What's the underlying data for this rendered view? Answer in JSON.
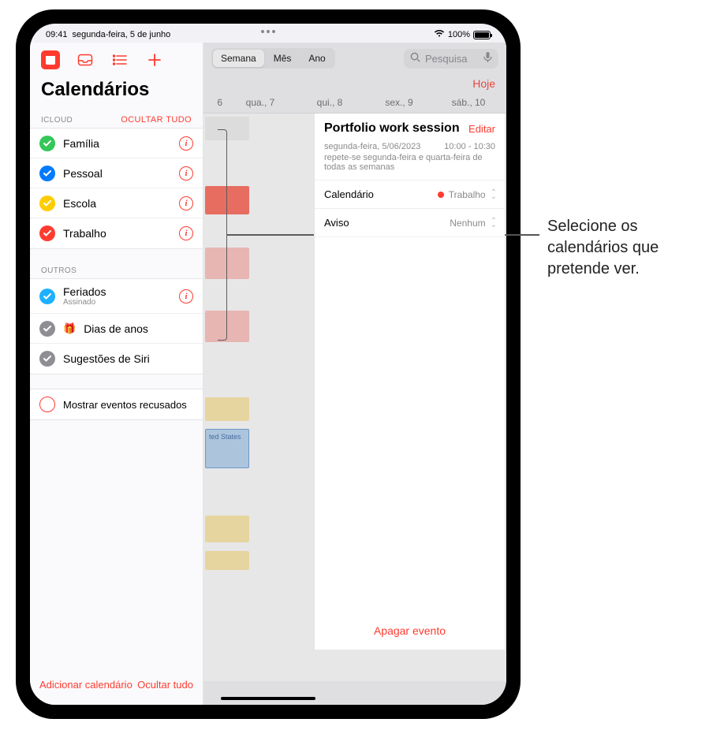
{
  "status": {
    "time": "09:41",
    "date": "segunda-feira, 5 de junho",
    "battery_pct": "100%"
  },
  "sidebar": {
    "title": "Calendários",
    "sections": {
      "icloud": {
        "name": "ICLOUD",
        "action": "OCULTAR TUDO"
      },
      "outros": {
        "name": "OUTROS"
      }
    },
    "icloud_items": [
      {
        "label": "Família",
        "color": "#34c759"
      },
      {
        "label": "Pessoal",
        "color": "#007aff"
      },
      {
        "label": "Escola",
        "color": "#ffcc00"
      },
      {
        "label": "Trabalho",
        "color": "#ff3b30"
      }
    ],
    "outros_items": [
      {
        "label": "Feriados",
        "sub": "Assinado",
        "color": "#1db0ff",
        "has_info": true
      },
      {
        "label": "Dias de anos",
        "color": "#8e8e93",
        "birthday": true
      },
      {
        "label": "Sugestões de Siri",
        "color": "#8e8e93"
      }
    ],
    "declined_label": "Mostrar eventos recusados",
    "footer": {
      "add": "Adicionar calendário",
      "hide": "Ocultar tudo"
    }
  },
  "main": {
    "segments": {
      "week": "Semana",
      "month": "Mês",
      "year": "Ano"
    },
    "search_placeholder": "Pesquisa",
    "today": "Hoje",
    "day_headers": {
      "d0": "6",
      "d1": "qua., 7",
      "d2": "qui., 8",
      "d3": "sex., 9",
      "d4": "sáb., 10"
    },
    "snippet_label": "ted States"
  },
  "event": {
    "title": "Portfolio work session",
    "edit": "Editar",
    "date": "segunda-feira, 5/06/2023",
    "time": "10:00 - 10:30",
    "recurrence": "repete-se segunda-feira e quarta-feira de todas as semanas",
    "calendar_field": "Calendário",
    "calendar_value": "Trabalho",
    "aviso_field": "Aviso",
    "aviso_value": "Nenhum",
    "delete": "Apagar evento"
  },
  "callout": {
    "line1": "Selecione os",
    "line2": "calendários que",
    "line3": "pretende ver."
  },
  "colors": {
    "accent": "#ff3b30"
  }
}
